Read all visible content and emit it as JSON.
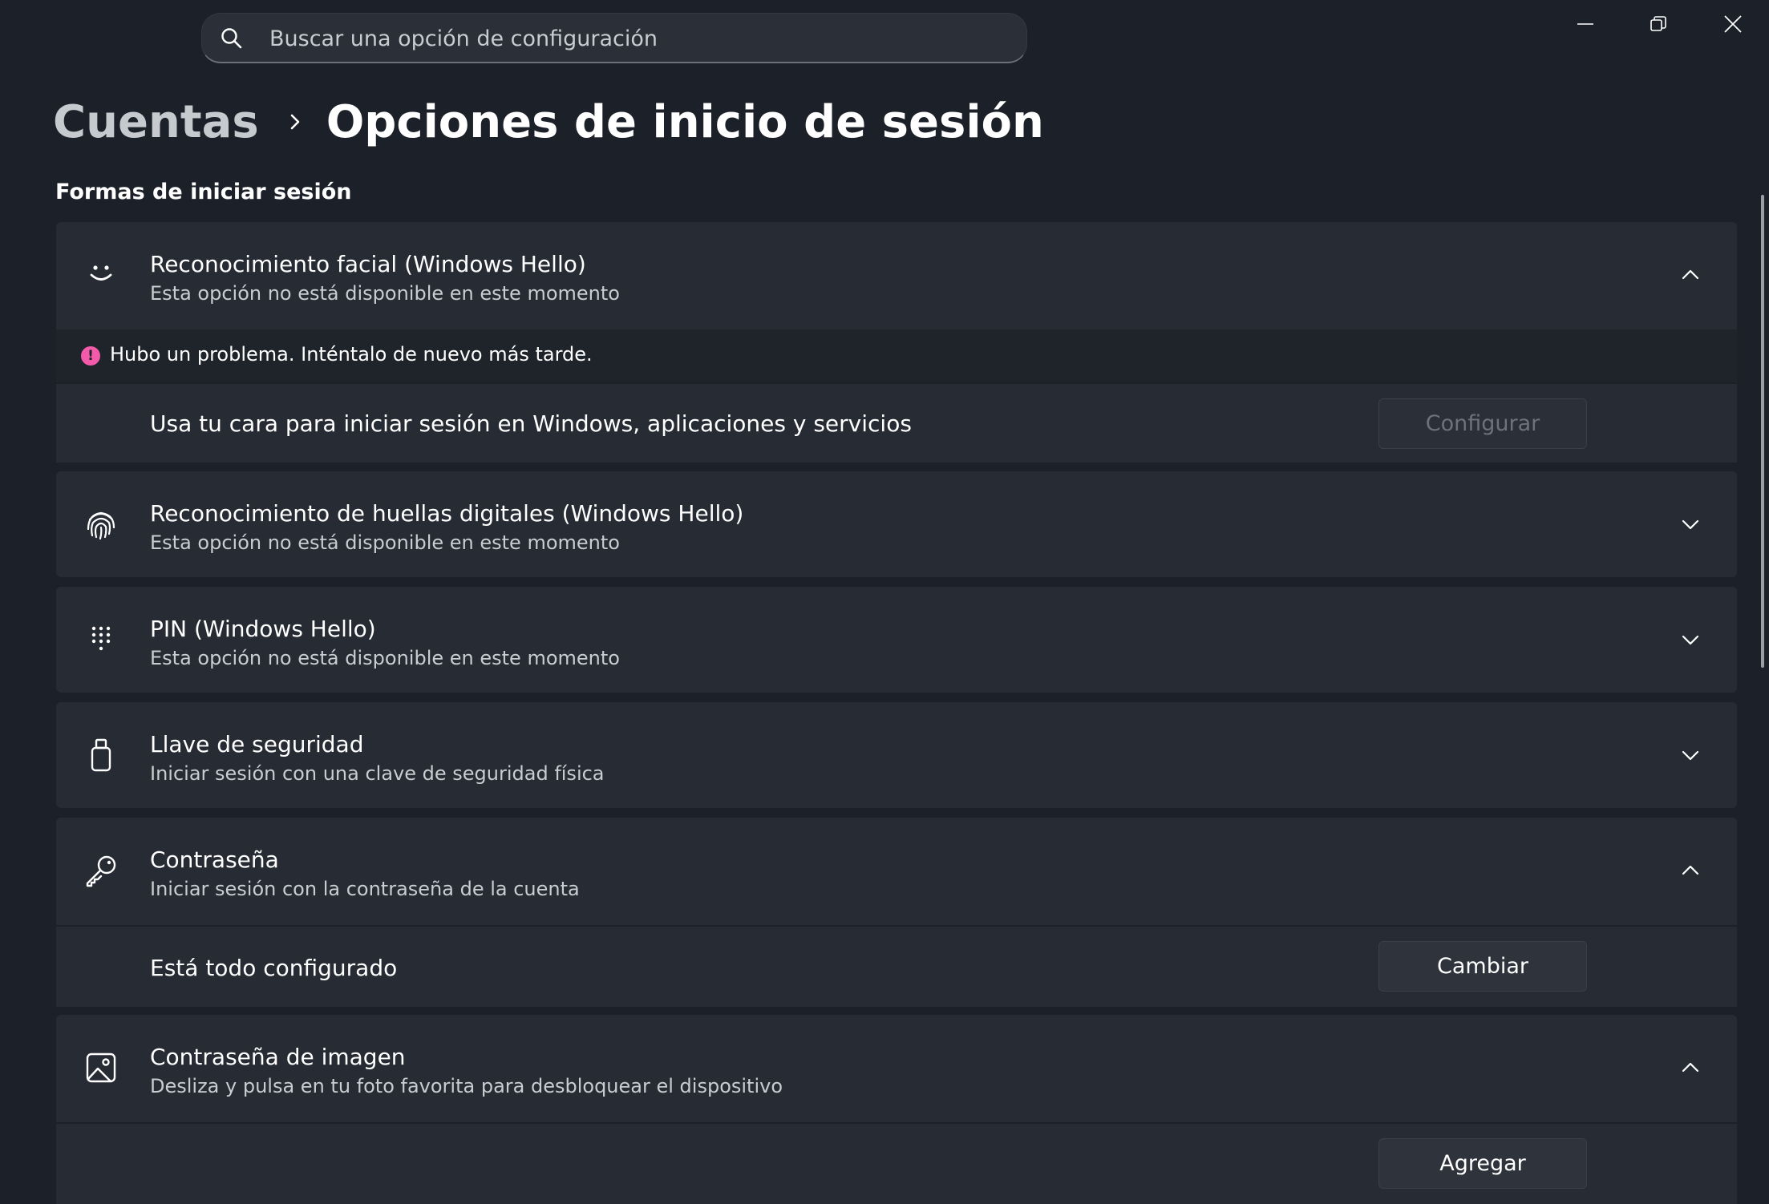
{
  "search": {
    "placeholder": "Buscar una opción de configuración"
  },
  "window": {
    "minimize": "minimize-icon",
    "restore": "restore-icon",
    "close": "close-icon"
  },
  "breadcrumb": {
    "parent": "Cuentas",
    "current": "Opciones de inicio de sesión"
  },
  "section_title": "Formas de iniciar sesión",
  "cards": [
    {
      "icon": "face-icon",
      "title": "Reconocimiento facial (Windows Hello)",
      "subtitle": "Esta opción no está disponible en este momento",
      "expanded": true,
      "error": "Hubo un problema. Inténtalo de nuevo más tarde.",
      "detail_text": "Usa tu cara para iniciar sesión en Windows, aplicaciones y servicios",
      "button": "Configurar",
      "button_disabled": true
    },
    {
      "icon": "fingerprint-icon",
      "title": "Reconocimiento de huellas digitales (Windows Hello)",
      "subtitle": "Esta opción no está disponible en este momento",
      "expanded": false
    },
    {
      "icon": "pin-keypad-icon",
      "title": "PIN (Windows Hello)",
      "subtitle": "Esta opción no está disponible en este momento",
      "expanded": false
    },
    {
      "icon": "security-key-icon",
      "title": "Llave de seguridad",
      "subtitle": "Iniciar sesión con una clave de seguridad física",
      "expanded": false
    },
    {
      "icon": "key-icon",
      "title": "Contraseña",
      "subtitle": "Iniciar sesión con la contraseña de la cuenta",
      "expanded": true,
      "detail_text": "Está todo configurado",
      "button": "Cambiar",
      "button_disabled": false
    },
    {
      "icon": "picture-password-icon",
      "title": "Contraseña de imagen",
      "subtitle": "Desliza y pulsa en tu foto favorita para desbloquear el dispositivo",
      "expanded": true,
      "button": "Agregar",
      "button_disabled": false
    }
  ]
}
